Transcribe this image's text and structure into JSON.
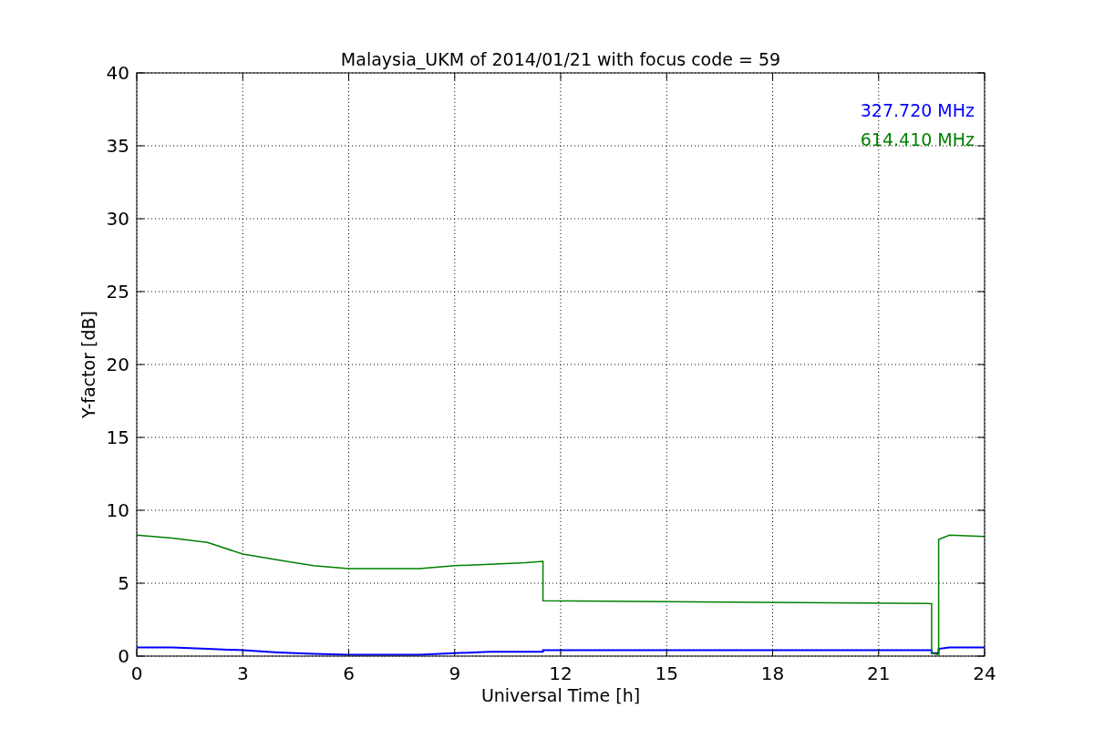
{
  "plot": {
    "chart_data": {
      "type": "line",
      "title": "Malaysia_UKM of 2014/01/21 with focus code = 59",
      "xlabel": "Universal Time [h]",
      "ylabel": "Y-factor [dB]",
      "x": [
        0,
        1,
        2,
        3,
        4,
        5,
        6,
        7,
        8,
        9,
        10,
        11,
        11.5,
        11.5,
        22.5,
        22.5,
        22.7,
        22.7,
        23,
        24
      ],
      "series": [
        {
          "name": "327.720 MHz",
          "color": "#0000ff",
          "values": [
            0.6,
            0.6,
            0.5,
            0.4,
            0.25,
            0.15,
            0.1,
            0.1,
            0.1,
            0.2,
            0.3,
            0.3,
            0.3,
            0.4,
            0.4,
            0.2,
            0.2,
            0.5,
            0.6,
            0.6
          ]
        },
        {
          "name": "614.410 MHz",
          "color": "#008000",
          "values": [
            8.3,
            8.1,
            7.8,
            7.0,
            6.6,
            6.2,
            6.0,
            6.0,
            6.0,
            6.2,
            6.3,
            6.4,
            6.5,
            3.8,
            3.6,
            0.2,
            0.1,
            8.0,
            8.3,
            8.2
          ]
        }
      ],
      "xlim": [
        0,
        24
      ],
      "ylim": [
        0,
        40
      ],
      "xticks": [
        0,
        3,
        6,
        9,
        12,
        15,
        18,
        21,
        24
      ],
      "yticks": [
        0,
        5,
        10,
        15,
        20,
        25,
        30,
        35,
        40
      ],
      "grid": true
    }
  }
}
